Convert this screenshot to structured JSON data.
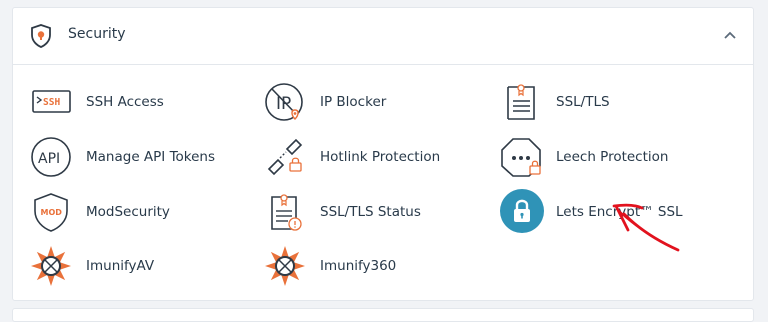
{
  "section": {
    "title": "Security",
    "icon": "shield-lock-icon",
    "collapse_icon": "chevron-up-icon"
  },
  "items": [
    {
      "label": "SSH Access",
      "icon": "ssh-terminal-icon"
    },
    {
      "label": "IP Blocker",
      "icon": "ip-blocker-icon"
    },
    {
      "label": "SSL/TLS",
      "icon": "certificate-icon"
    },
    {
      "label": "Manage API Tokens",
      "icon": "api-icon"
    },
    {
      "label": "Hotlink Protection",
      "icon": "broken-link-icon"
    },
    {
      "label": "Leech Protection",
      "icon": "leech-octagon-icon"
    },
    {
      "label": "ModSecurity",
      "icon": "mod-shield-icon"
    },
    {
      "label": "SSL/TLS Status",
      "icon": "certificate-status-icon"
    },
    {
      "label": "Lets Encrypt™ SSL",
      "icon": "padlock-circle-icon"
    },
    {
      "label": "ImunifyAV",
      "icon": "imunify-star-icon"
    },
    {
      "label": "Imunify360",
      "icon": "imunify-star-icon"
    }
  ],
  "colors": {
    "accent_orange": "#e9713a",
    "icon_dark": "#2f3a46",
    "lock_blue": "#2f93b7",
    "annotation_red": "#e2121e"
  }
}
